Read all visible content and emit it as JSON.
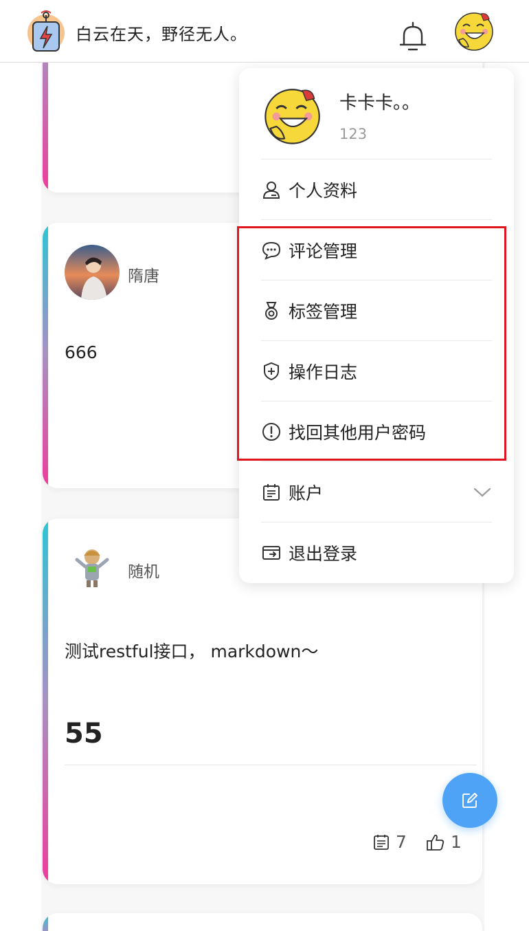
{
  "header": {
    "site_title": "白云在天，野径无人。"
  },
  "feed": {
    "cards": [
      {
        "author": "隋唐",
        "text": "666"
      },
      {
        "author": "随机",
        "text": "测试restful接口， markdown～",
        "heading": "55",
        "comments": "7",
        "likes": "1"
      }
    ]
  },
  "dropdown": {
    "username": "卡卡卡。。",
    "user_id": "123",
    "items": [
      {
        "label": "个人资料",
        "icon": "user-icon"
      },
      {
        "label": "评论管理",
        "icon": "chat-bubble-icon"
      },
      {
        "label": "标签管理",
        "icon": "medal-icon"
      },
      {
        "label": "操作日志",
        "icon": "shield-plus-icon"
      },
      {
        "label": "找回其他用户密码",
        "icon": "exclamation-circle-icon"
      },
      {
        "label": "账户",
        "icon": "calendar-icon"
      },
      {
        "label": "退出登录",
        "icon": "logout-icon"
      }
    ]
  },
  "colors": {
    "accent_blue": "#4ea3f7",
    "highlight_red": "#e0141e",
    "card_gradient": [
      "#2cc6d4",
      "#a98fc4",
      "#ee3c9c"
    ]
  }
}
